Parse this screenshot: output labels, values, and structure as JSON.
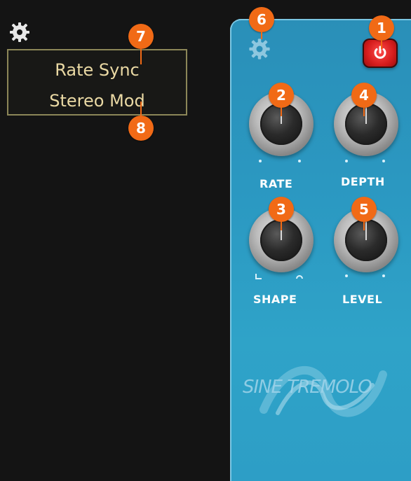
{
  "menu": {
    "items": [
      "Rate Sync",
      "Stereo Mod"
    ]
  },
  "pedal": {
    "title": "SINE TREMOLO",
    "knobs": [
      {
        "label": "RATE"
      },
      {
        "label": "DEPTH"
      },
      {
        "label": "SHAPE"
      },
      {
        "label": "LEVEL"
      }
    ]
  },
  "callouts": [
    "1",
    "2",
    "3",
    "4",
    "5",
    "6",
    "7",
    "8"
  ],
  "colors": {
    "pedal": "#2b99c2",
    "callout": "#f16a16",
    "menu_text": "#ead9a4",
    "power": "#d51d1d"
  }
}
